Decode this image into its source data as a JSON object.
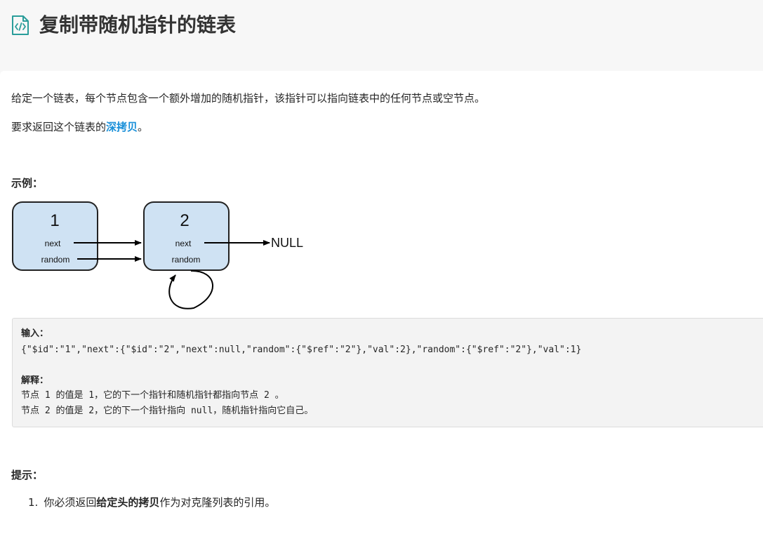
{
  "header": {
    "icon": "code-document-icon",
    "title": "复制带随机指针的链表"
  },
  "description": {
    "line1": "给定一个链表，每个节点包含一个额外增加的随机指针，该指针可以指向链表中的任何节点或空节点。",
    "line2_prefix": "要求返回这个链表的",
    "line2_link": "深拷贝",
    "line2_suffix": "。"
  },
  "example": {
    "heading": "示例：",
    "diagram": {
      "node1": {
        "value": "1",
        "next_label": "next",
        "random_label": "random"
      },
      "node2": {
        "value": "2",
        "next_label": "next",
        "random_label": "random"
      },
      "null_label": "NULL"
    },
    "code": {
      "input_label": "输入：",
      "input_value": "{\"$id\":\"1\",\"next\":{\"$id\":\"2\",\"next\":null,\"random\":{\"$ref\":\"2\"},\"val\":2},\"random\":{\"$ref\":\"2\"},\"val\":1}",
      "explain_label": "解释：",
      "explain_line1": "节点 1 的值是 1，它的下一个指针和随机指针都指向节点 2 。",
      "explain_line2": "节点 2 的值是 2，它的下一个指针指向 null，随机指针指向它自己。"
    }
  },
  "hints": {
    "heading": "提示：",
    "items": [
      {
        "number": "1.",
        "prefix": "你必须返回",
        "bold": "给定头的拷贝",
        "suffix": "作为对克隆列表的引用。"
      }
    ]
  },
  "colors": {
    "accent_link": "#1a90d9",
    "icon_teal": "#2a9d9a",
    "node_fill": "#cfe2f3",
    "code_bg": "#f3f3f3"
  }
}
